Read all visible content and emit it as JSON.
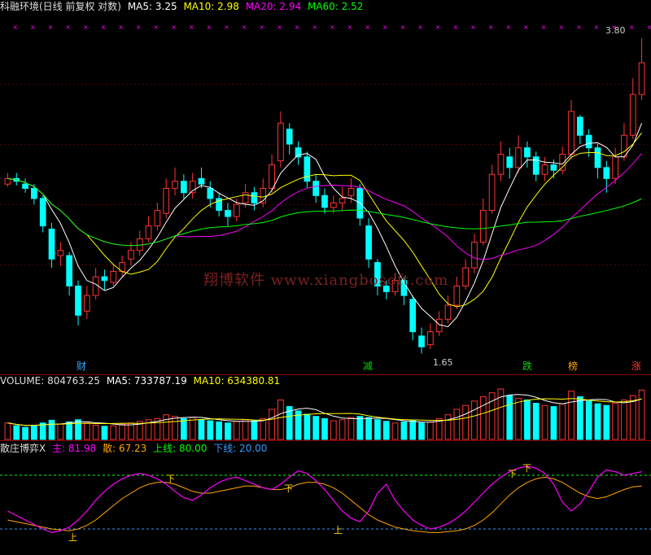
{
  "main_header": {
    "title": "科融环境(日线 前复权 对数)",
    "ma5": "MA5: 3.25",
    "ma10": "MA10: 2.98",
    "ma20": "MA20: 2.94",
    "ma60": "MA60: 2.52"
  },
  "price_labels": {
    "high": "3.80",
    "low": "1.65"
  },
  "signals": [
    "财",
    "减",
    "跌",
    "榜",
    "涨"
  ],
  "watermark": "翔博软件 www.xiangbosoft.com",
  "volume_header": {
    "volume": "VOLUME: 804763.25",
    "ma5": "MA5: 733787.19",
    "ma10": "MA10: 634380.81"
  },
  "indicator_header": {
    "name": "散庄博弈X",
    "main": "主: 81.98",
    "scatter": "散: 67.23",
    "upper": "上线: 80.00",
    "lower": "下线: 20.00"
  },
  "indicator_marks": {
    "up": "上",
    "down": "下"
  },
  "colors": {
    "up": "#ff3333",
    "down": "#00ffff",
    "ma5": "#ffffff",
    "ma10": "#ffff00",
    "ma20": "#ff00ff",
    "ma60": "#00ff00",
    "sep": "#8b0000"
  },
  "chart_data": {
    "type": "candlestick",
    "price_scale": "log",
    "y_range": [
      1.6,
      4.0
    ],
    "points": [
      [
        2.58,
        2.62,
        2.66,
        2.56
      ],
      [
        2.62,
        2.6,
        2.66,
        2.57
      ],
      [
        2.58,
        2.55,
        2.62,
        2.52
      ],
      [
        2.55,
        2.48,
        2.58,
        2.44
      ],
      [
        2.48,
        2.3,
        2.5,
        2.26
      ],
      [
        2.28,
        2.1,
        2.32,
        2.05
      ],
      [
        2.12,
        2.15,
        2.2,
        2.06
      ],
      [
        2.12,
        1.95,
        2.14,
        1.9
      ],
      [
        1.95,
        1.8,
        1.98,
        1.75
      ],
      [
        1.82,
        1.9,
        1.95,
        1.78
      ],
      [
        1.9,
        2.0,
        2.05,
        1.88
      ],
      [
        2.0,
        1.98,
        2.04,
        1.93
      ],
      [
        1.97,
        2.03,
        2.07,
        1.95
      ],
      [
        2.03,
        2.08,
        2.12,
        2.0
      ],
      [
        2.1,
        2.15,
        2.2,
        2.06
      ],
      [
        2.15,
        2.22,
        2.27,
        2.12
      ],
      [
        2.22,
        2.3,
        2.36,
        2.2
      ],
      [
        2.3,
        2.4,
        2.45,
        2.27
      ],
      [
        2.38,
        2.55,
        2.62,
        2.35
      ],
      [
        2.55,
        2.6,
        2.7,
        2.5
      ],
      [
        2.6,
        2.52,
        2.65,
        2.48
      ],
      [
        2.52,
        2.6,
        2.66,
        2.48
      ],
      [
        2.62,
        2.58,
        2.7,
        2.55
      ],
      [
        2.55,
        2.48,
        2.6,
        2.42
      ],
      [
        2.48,
        2.4,
        2.52,
        2.36
      ],
      [
        2.4,
        2.36,
        2.45,
        2.3
      ],
      [
        2.36,
        2.44,
        2.48,
        2.33
      ],
      [
        2.45,
        2.52,
        2.58,
        2.42
      ],
      [
        2.52,
        2.45,
        2.56,
        2.4
      ],
      [
        2.45,
        2.55,
        2.62,
        2.42
      ],
      [
        2.55,
        2.72,
        2.8,
        2.52
      ],
      [
        2.75,
        3.05,
        3.15,
        2.7
      ],
      [
        3.0,
        2.88,
        3.05,
        2.8
      ],
      [
        2.85,
        2.78,
        2.9,
        2.72
      ],
      [
        2.78,
        2.6,
        2.82,
        2.55
      ],
      [
        2.6,
        2.5,
        2.65,
        2.45
      ],
      [
        2.5,
        2.42,
        2.55,
        2.38
      ],
      [
        2.42,
        2.45,
        2.5,
        2.38
      ],
      [
        2.45,
        2.48,
        2.56,
        2.4
      ],
      [
        2.5,
        2.55,
        2.62,
        2.45
      ],
      [
        2.55,
        2.35,
        2.58,
        2.3
      ],
      [
        2.3,
        2.1,
        2.35,
        2.05
      ],
      [
        2.08,
        1.95,
        2.1,
        1.9
      ],
      [
        1.95,
        1.92,
        1.98,
        1.88
      ],
      [
        1.92,
        1.98,
        2.02,
        1.9
      ],
      [
        1.98,
        1.9,
        2.0,
        1.85
      ],
      [
        1.88,
        1.72,
        1.9,
        1.68
      ],
      [
        1.7,
        1.65,
        1.74,
        1.62
      ],
      [
        1.66,
        1.72,
        1.76,
        1.64
      ],
      [
        1.72,
        1.78,
        1.82,
        1.7
      ],
      [
        1.78,
        1.85,
        1.9,
        1.76
      ],
      [
        1.85,
        1.95,
        2.0,
        1.83
      ],
      [
        1.95,
        2.05,
        2.1,
        1.93
      ],
      [
        2.05,
        2.2,
        2.25,
        2.02
      ],
      [
        2.2,
        2.4,
        2.48,
        2.18
      ],
      [
        2.4,
        2.65,
        2.72,
        2.38
      ],
      [
        2.65,
        2.8,
        2.9,
        2.6
      ],
      [
        2.78,
        2.7,
        2.85,
        2.62
      ],
      [
        2.7,
        2.85,
        2.95,
        2.66
      ],
      [
        2.85,
        2.78,
        2.9,
        2.7
      ],
      [
        2.78,
        2.65,
        2.82,
        2.6
      ],
      [
        2.65,
        2.72,
        2.78,
        2.6
      ],
      [
        2.72,
        2.68,
        2.76,
        2.62
      ],
      [
        2.68,
        2.8,
        2.86,
        2.65
      ],
      [
        2.8,
        3.15,
        3.25,
        2.76
      ],
      [
        3.1,
        2.95,
        3.12,
        2.88
      ],
      [
        2.95,
        2.85,
        3.0,
        2.78
      ],
      [
        2.85,
        2.7,
        2.88,
        2.62
      ],
      [
        2.7,
        2.62,
        2.75,
        2.52
      ],
      [
        2.62,
        2.78,
        2.85,
        2.58
      ],
      [
        2.78,
        2.95,
        3.05,
        2.75
      ],
      [
        2.95,
        3.3,
        3.45,
        2.92
      ],
      [
        3.3,
        3.6,
        3.85,
        3.25
      ]
    ],
    "volume": [
      0.3,
      0.25,
      0.22,
      0.26,
      0.3,
      0.35,
      0.28,
      0.32,
      0.36,
      0.3,
      0.26,
      0.24,
      0.25,
      0.28,
      0.3,
      0.33,
      0.36,
      0.38,
      0.45,
      0.42,
      0.38,
      0.4,
      0.36,
      0.34,
      0.32,
      0.3,
      0.33,
      0.36,
      0.34,
      0.38,
      0.55,
      0.72,
      0.6,
      0.52,
      0.46,
      0.42,
      0.38,
      0.34,
      0.36,
      0.4,
      0.42,
      0.4,
      0.36,
      0.33,
      0.3,
      0.32,
      0.34,
      0.3,
      0.32,
      0.38,
      0.45,
      0.55,
      0.62,
      0.7,
      0.78,
      0.85,
      0.92,
      0.8,
      0.75,
      0.72,
      0.66,
      0.62,
      0.6,
      0.65,
      0.88,
      0.78,
      0.7,
      0.65,
      0.62,
      0.66,
      0.72,
      0.8,
      0.9
    ],
    "main_line": [
      40,
      35,
      30,
      25,
      20,
      16,
      18,
      22,
      30,
      40,
      52,
      62,
      70,
      76,
      80,
      82,
      80,
      76,
      70,
      62,
      55,
      52,
      58,
      66,
      72,
      76,
      78,
      74,
      70,
      66,
      64,
      70,
      78,
      85,
      82,
      74,
      64,
      52,
      40,
      32,
      28,
      40,
      60,
      70,
      52,
      40,
      30,
      24,
      20,
      22,
      26,
      32,
      40,
      50,
      60,
      70,
      78,
      84,
      88,
      90,
      88,
      82,
      70,
      50,
      40,
      48,
      62,
      78,
      86,
      84,
      80,
      82,
      84
    ],
    "scatter_line": [
      30,
      28,
      26,
      24,
      22,
      20,
      19,
      18,
      20,
      24,
      30,
      38,
      46,
      54,
      60,
      66,
      70,
      72,
      72,
      70,
      66,
      62,
      60,
      60,
      62,
      64,
      66,
      68,
      68,
      66,
      64,
      64,
      66,
      70,
      72,
      72,
      70,
      66,
      60,
      52,
      44,
      36,
      30,
      26,
      22,
      20,
      18,
      17,
      16,
      16,
      17,
      18,
      20,
      24,
      30,
      38,
      48,
      58,
      66,
      72,
      76,
      78,
      76,
      72,
      66,
      60,
      56,
      54,
      56,
      60,
      64,
      67,
      68
    ]
  }
}
